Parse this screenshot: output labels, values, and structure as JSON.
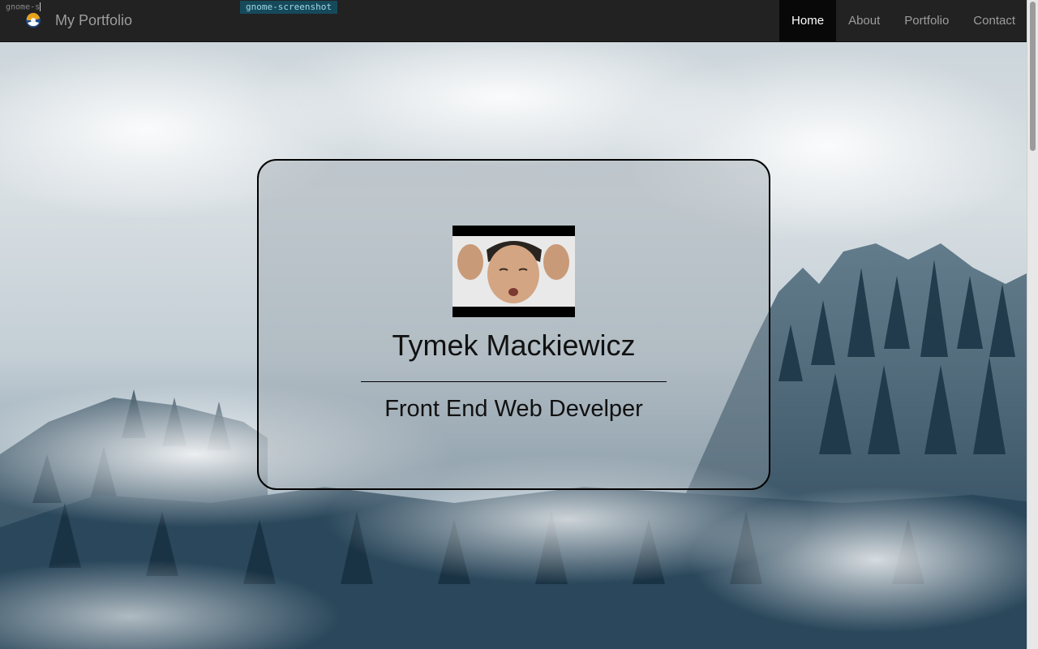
{
  "terminal": {
    "typed_text": "gnome-s",
    "tooltip": "gnome-screenshot"
  },
  "navbar": {
    "brand": "My Portfolio",
    "items": [
      {
        "label": "Home",
        "active": true
      },
      {
        "label": "About",
        "active": false
      },
      {
        "label": "Portfolio",
        "active": false
      },
      {
        "label": "Contact",
        "active": false
      }
    ]
  },
  "profile": {
    "name": "Tymek Mackiewicz",
    "role": "Front End Web Develper"
  },
  "colors": {
    "navbar_bg": "#222222",
    "active_item_bg": "#080808",
    "nav_text": "#9d9d9d",
    "active_text": "#ffffff",
    "tooltip_bg": "#164a5b"
  }
}
